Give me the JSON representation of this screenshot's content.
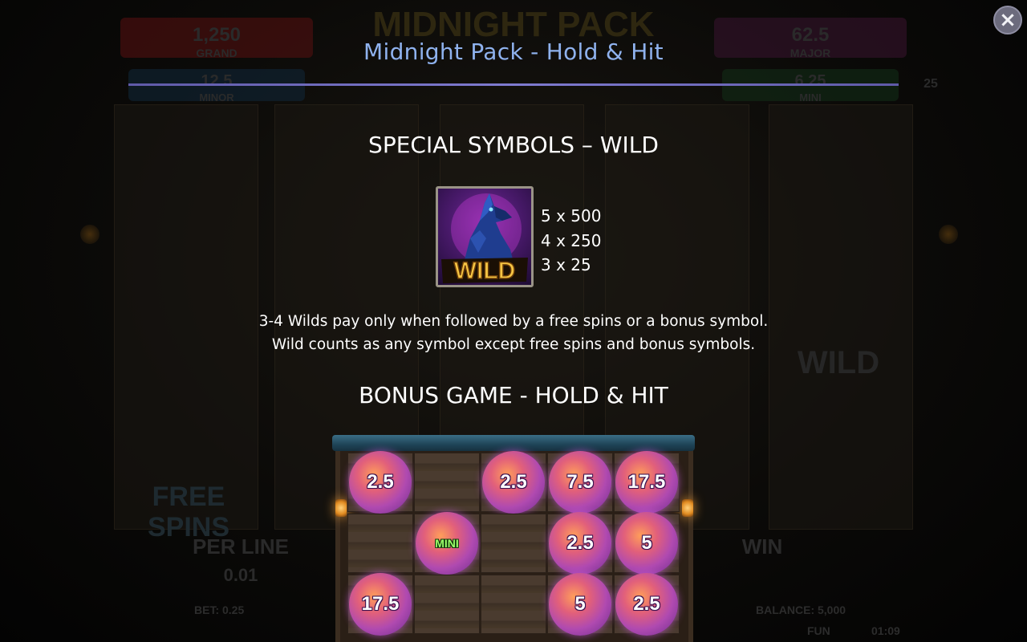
{
  "popup": {
    "title": "Midnight Pack - Hold & Hit",
    "close_icon": "×"
  },
  "wild_section": {
    "heading": "SPECIAL SYMBOLS – WILD",
    "symbol_label": "WILD",
    "paytable": [
      "5 x 500",
      "4 x 250",
      "3 x 25"
    ],
    "desc_line1": "3-4 Wilds pay only when followed by a free spins or a bonus symbol.",
    "desc_line2": "Wild counts as any symbol except free spins and bonus symbols."
  },
  "bonus_section": {
    "heading": "BONUS GAME - HOLD & HIT",
    "grid": [
      [
        "2.5",
        "",
        "2.5",
        "7.5",
        "17.5"
      ],
      [
        "",
        "MINI",
        "",
        "2.5",
        "5"
      ],
      [
        "17.5",
        "",
        "",
        "5",
        "2.5"
      ]
    ]
  },
  "background": {
    "game_logo": "MIDNIGHT PACK",
    "jackpots": [
      {
        "value": "1,250",
        "label": "GRAND"
      },
      {
        "value": "62.5",
        "label": "MAJOR"
      },
      {
        "value": "12.5",
        "label": "MINOR"
      },
      {
        "value": "6.25",
        "label": "MINI"
      }
    ],
    "lines_badge": "25",
    "per_line_label": "PER LINE",
    "per_line_value": "0.01",
    "win_label": "WIN",
    "bet_text": "BET: 0.25",
    "balance_text": "BALANCE: 5,000",
    "mode_text": "FUN",
    "clock_text": "01:09",
    "reel_wild": "WILD",
    "free_spins": [
      "FREE",
      "SPINS"
    ]
  },
  "colors": {
    "title": "#8fb2ee",
    "rule": "#7f7bd0",
    "grand": "#5a1010",
    "major": "#3a1430",
    "minor": "#10283a",
    "mini": "#123018"
  }
}
